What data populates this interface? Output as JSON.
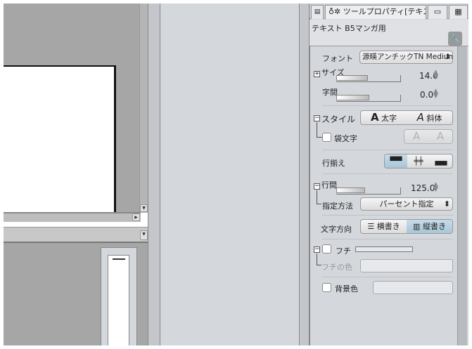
{
  "tabs": {
    "tool_property": "ツールプロパティ[テキス"
  },
  "header": {
    "subtool": "テキスト B5マンガ用"
  },
  "props": {
    "font_label": "フォント",
    "font_value": "源暎アンチックTN Medium",
    "size_label": "サイズ",
    "size_value": "14.0",
    "size_fill": 0.35,
    "spacing_label": "字間",
    "spacing_value": "0.0",
    "spacing_fill": 0.42,
    "style_label": "スタイル",
    "bold": "太字",
    "italic": "斜体",
    "outline_text_label": "袋文字",
    "align_label": "行揃え",
    "line_spacing_label": "行間",
    "line_spacing_value": "125.0",
    "line_spacing_fill": 0.42,
    "method_label": "指定方法",
    "method_value": "パーセント指定",
    "direction_label": "文字方向",
    "horizontal": "横書き",
    "vertical": "縦書き",
    "edge_label": "フチ",
    "edge_color_label": "フチの色",
    "bg_color_label": "背景色"
  }
}
